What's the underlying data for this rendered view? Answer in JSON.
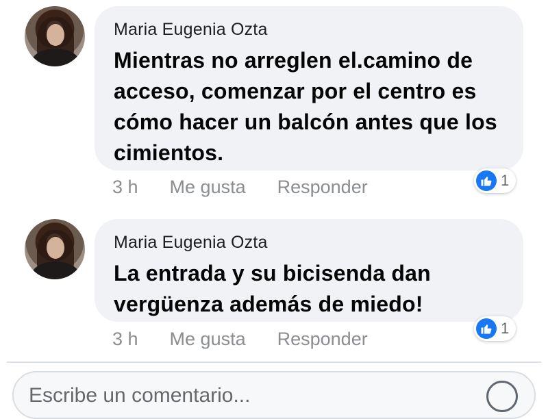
{
  "comments": [
    {
      "author": "Maria Eugenia Ozta",
      "text": "Mientras no arreglen el.camino de acceso, comenzar por el centro es cómo hacer un balcón antes que los cimientos.",
      "time": "3 h",
      "like_label": "Me gusta",
      "reply_label": "Responder",
      "reaction_count": "1",
      "reaction_icon": "thumbs-up-icon"
    },
    {
      "author": "Maria Eugenia Ozta",
      "text": "La entrada y su bicisenda dan vergüenza además de miedo!",
      "time": "3 h",
      "like_label": "Me gusta",
      "reply_label": "Responder",
      "reaction_count": "1",
      "reaction_icon": "thumbs-up-icon"
    }
  ],
  "composer": {
    "placeholder": "Escribe un comentario..."
  },
  "colors": {
    "bubble": "#f0f2f5",
    "like_blue": "#1877f2",
    "meta_gray": "#8a8d91"
  }
}
